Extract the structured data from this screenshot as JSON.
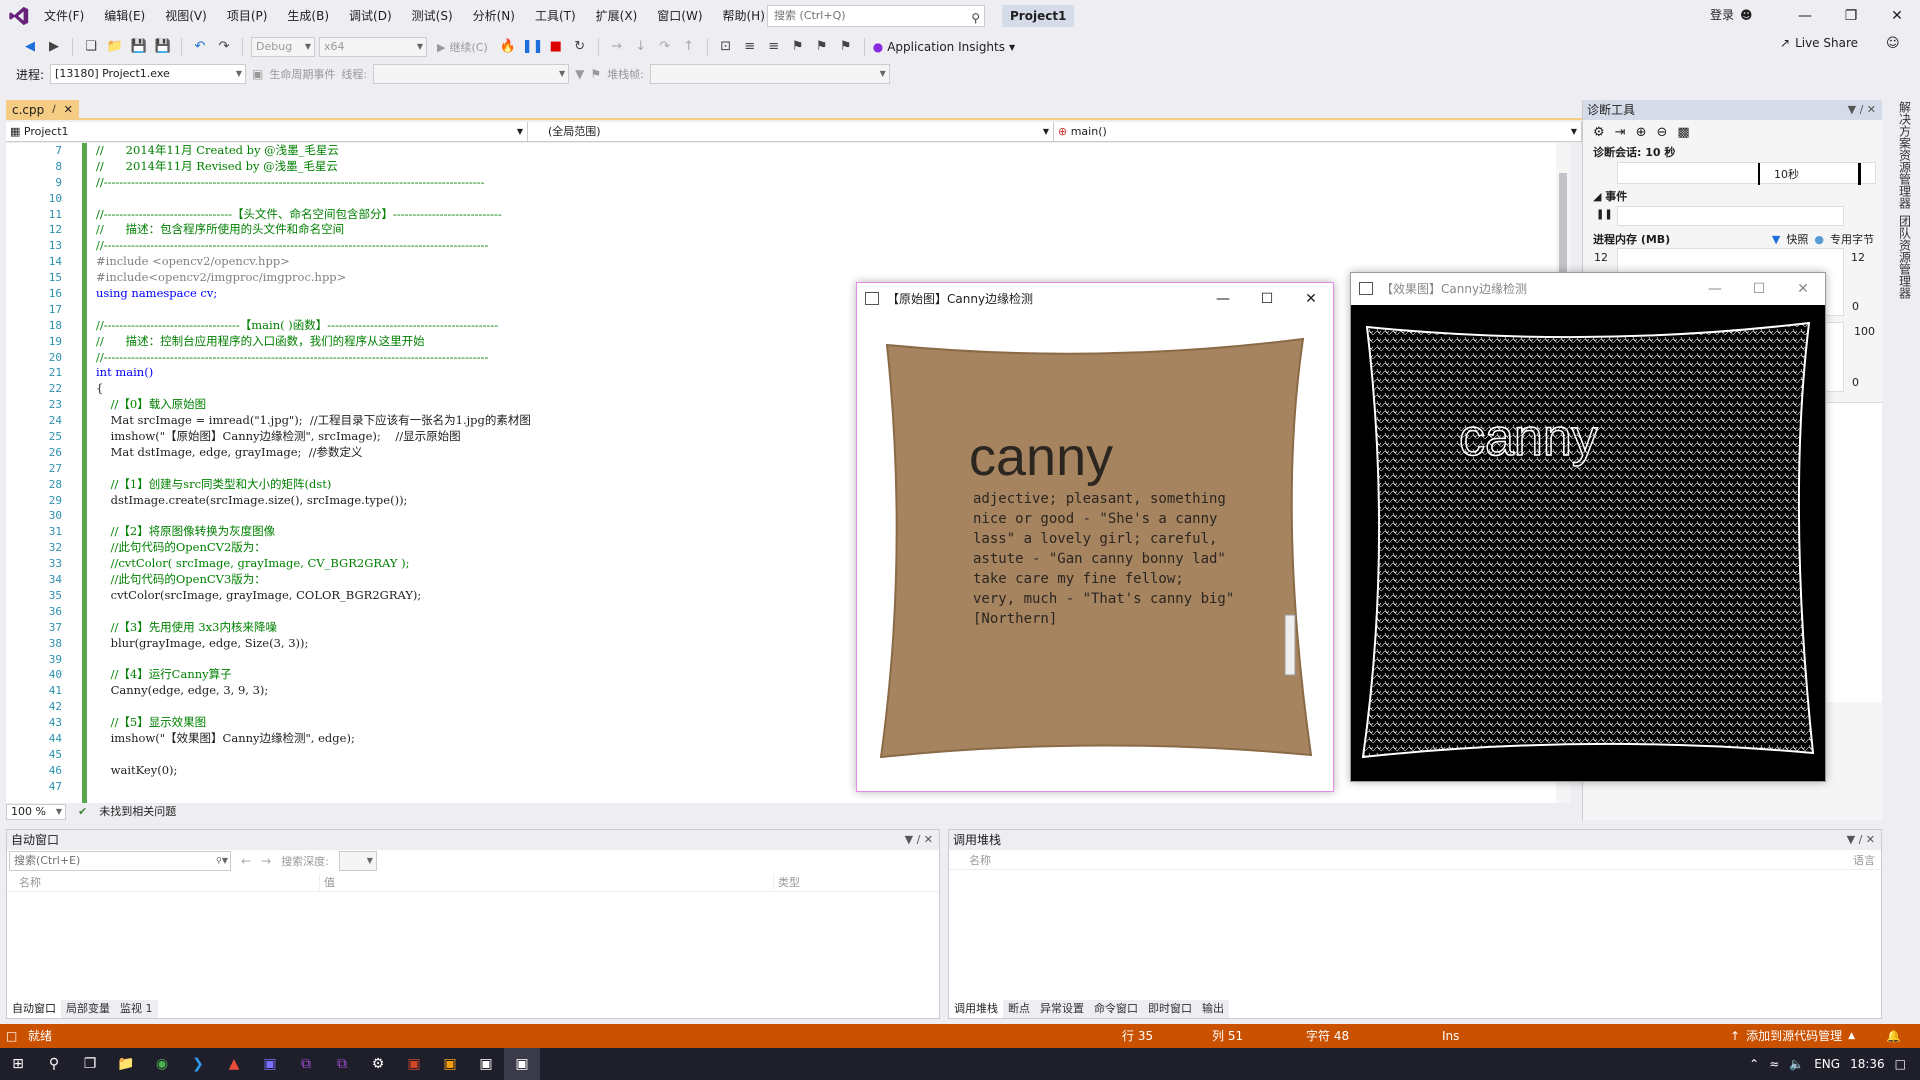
{
  "title_bar": {
    "menus": [
      "文件(F)",
      "编辑(E)",
      "视图(V)",
      "项目(P)",
      "生成(B)",
      "调试(D)",
      "测试(S)",
      "分析(N)",
      "工具(T)",
      "扩展(X)",
      "窗口(W)",
      "帮助(H)"
    ],
    "search_placeholder": "搜索 (Ctrl+Q)",
    "project": "Project1",
    "login": "登录"
  },
  "toolbar": {
    "config": "Debug",
    "platform": "x64",
    "continue": "继续(C)",
    "app_insights": "Application Insights",
    "live_share": "Live Share",
    "process_label": "进程:",
    "process_value": "[13180] Project1.exe",
    "lifecycle": "生命周期事件",
    "thread_label": "线程:",
    "stack_label": "堆栈帧:"
  },
  "editor": {
    "tab": "c.cpp",
    "nav_project": "Project1",
    "nav_scope": "(全局范围)",
    "nav_member": "main()",
    "zoom": "100 %",
    "issues": "未找到相关问题",
    "lines": [
      {
        "n": "7",
        "t": "//      2014年11月 Created by @浅墨_毛星云",
        "c": "cm"
      },
      {
        "n": "8",
        "t": "//      2014年11月 Revised by @浅墨_毛星云",
        "c": "cm"
      },
      {
        "n": "9",
        "t": "//--------------------------------------------------------------------------------------------------",
        "c": "cm"
      },
      {
        "n": "10",
        "t": "",
        "c": ""
      },
      {
        "n": "11",
        "t": "//---------------------------------【头文件、命名空间包含部分】----------------------------",
        "c": "cm"
      },
      {
        "n": "12",
        "t": "//      描述：包含程序所使用的头文件和命名空间",
        "c": "cm"
      },
      {
        "n": "13",
        "t": "//---------------------------------------------------------------------------------------------------",
        "c": "cm"
      },
      {
        "n": "14",
        "t": "#include <opencv2/opencv.hpp>",
        "c": "pp"
      },
      {
        "n": "15",
        "t": "#include<opencv2/imgproc/imgproc.hpp>",
        "c": "pp"
      },
      {
        "n": "16",
        "t": "using namespace cv;",
        "c": "kw"
      },
      {
        "n": "17",
        "t": "",
        "c": ""
      },
      {
        "n": "18",
        "t": "//-----------------------------------【main( )函数】--------------------------------------------",
        "c": "cm"
      },
      {
        "n": "19",
        "t": "//      描述：控制台应用程序的入口函数，我们的程序从这里开始",
        "c": "cm"
      },
      {
        "n": "20",
        "t": "//---------------------------------------------------------------------------------------------------",
        "c": "cm"
      },
      {
        "n": "21",
        "t": "int main()",
        "c": "kw"
      },
      {
        "n": "22",
        "t": "{",
        "c": ""
      },
      {
        "n": "23",
        "t": "    //【0】载入原始图",
        "c": "cm"
      },
      {
        "n": "24",
        "t": "    Mat srcImage = imread(\"1.jpg\");  //工程目录下应该有一张名为1.jpg的素材图",
        "c": ""
      },
      {
        "n": "25",
        "t": "    imshow(\"【原始图】Canny边缘检测\", srcImage);    //显示原始图",
        "c": ""
      },
      {
        "n": "26",
        "t": "    Mat dstImage, edge, grayImage;  //参数定义",
        "c": ""
      },
      {
        "n": "27",
        "t": "",
        "c": ""
      },
      {
        "n": "28",
        "t": "    //【1】创建与src同类型和大小的矩阵(dst)",
        "c": "cm"
      },
      {
        "n": "29",
        "t": "    dstImage.create(srcImage.size(), srcImage.type());",
        "c": ""
      },
      {
        "n": "30",
        "t": "",
        "c": ""
      },
      {
        "n": "31",
        "t": "    //【2】将原图像转换为灰度图像",
        "c": "cm"
      },
      {
        "n": "32",
        "t": "    //此句代码的OpenCV2版为：",
        "c": "cm"
      },
      {
        "n": "33",
        "t": "    //cvtColor( srcImage, grayImage, CV_BGR2GRAY );",
        "c": "cm"
      },
      {
        "n": "34",
        "t": "    //此句代码的OpenCV3版为：",
        "c": "cm"
      },
      {
        "n": "35",
        "t": "    cvtColor(srcImage, grayImage, COLOR_BGR2GRAY);",
        "c": ""
      },
      {
        "n": "36",
        "t": "",
        "c": ""
      },
      {
        "n": "37",
        "t": "    //【3】先用使用 3x3内核来降噪",
        "c": "cm"
      },
      {
        "n": "38",
        "t": "    blur(grayImage, edge, Size(3, 3));",
        "c": ""
      },
      {
        "n": "39",
        "t": "",
        "c": ""
      },
      {
        "n": "40",
        "t": "    //【4】运行Canny算子",
        "c": "cm"
      },
      {
        "n": "41",
        "t": "    Canny(edge, edge, 3, 9, 3);",
        "c": ""
      },
      {
        "n": "42",
        "t": "",
        "c": ""
      },
      {
        "n": "43",
        "t": "    //【5】显示效果图",
        "c": "cm"
      },
      {
        "n": "44",
        "t": "    imshow(\"【效果图】Canny边缘检测\", edge);",
        "c": ""
      },
      {
        "n": "45",
        "t": "",
        "c": ""
      },
      {
        "n": "46",
        "t": "    waitKey(0);",
        "c": ""
      },
      {
        "n": "47",
        "t": "",
        "c": ""
      }
    ]
  },
  "diag": {
    "title": "诊断工具",
    "session": "诊断会话: 10 秒",
    "tick": "10秒",
    "events": "事件",
    "memory": "进程内存 (MB)",
    "snapshot": "快照",
    "private": "专用字节",
    "mem_max": "12",
    "mem_min": "0",
    "cpu_max": "100",
    "cpu_min": "0"
  },
  "right_strip": [
    "解决方案资源管理器",
    "团队资源管理器"
  ],
  "win_src": {
    "title": "【原始图】Canny边缘检测",
    "word": "canny",
    "text": [
      "adjective; pleasant, something",
      "nice or good - \"She's a canny",
      "lass\" a lovely girl; careful,",
      "astute - \"Gan canny bonny lad\"",
      "take care my fine fellow;",
      "very, much - \"That's canny big\"",
      "[Northern]"
    ]
  },
  "win_dst": {
    "title": "【效果图】Canny边缘检测",
    "word": "canny"
  },
  "autos": {
    "title": "自动窗口",
    "search": "搜索(Ctrl+E)",
    "depth": "搜索深度:",
    "cols": [
      "名称",
      "值",
      "类型"
    ],
    "tabs": [
      "自动窗口",
      "局部变量",
      "监视 1"
    ]
  },
  "callstack": {
    "title": "调用堆栈",
    "cols": [
      "名称",
      "语言"
    ],
    "tabs": [
      "调用堆栈",
      "断点",
      "异常设置",
      "命令窗口",
      "即时窗口",
      "输出"
    ]
  },
  "status": {
    "ready": "就绪",
    "line": "行 35",
    "col": "列 51",
    "char": "字符 48",
    "ins": "Ins",
    "source_control": "添加到源代码管理"
  },
  "taskbar": {
    "lang": "ENG",
    "time": "18:36"
  }
}
